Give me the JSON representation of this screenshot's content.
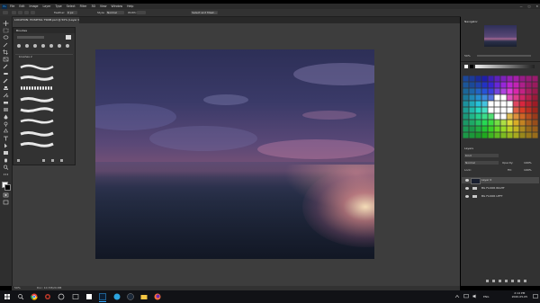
{
  "app": {
    "logo_text": "Ps",
    "menu": [
      "File",
      "Edit",
      "Image",
      "Layer",
      "Type",
      "Select",
      "Filter",
      "3D",
      "View",
      "Window",
      "Help"
    ],
    "window_controls": [
      "—",
      "□",
      "✕"
    ]
  },
  "options": {
    "feather_label": "Feather:",
    "feather_value": "0 px",
    "style_label": "Style:",
    "style_value": "Normal",
    "w_label": "Width:",
    "select_mask": "Select and Mask..."
  },
  "document": {
    "tab_title": "LOCATION: HOSPITAL TSNM.psd @ 50% (Layer 0, RGB/8)",
    "zoom": "50%",
    "doc_info": "Doc: 10.7M/20.8M"
  },
  "brushes_panel": {
    "title": "Brushes",
    "group_name": "brushes 2"
  },
  "navigator": {
    "title": "Navigator",
    "zoom": "50%"
  },
  "layers_panel": {
    "title": "Layers",
    "kind_label": "Kind",
    "blend_mode": "Normal",
    "opacity_label": "Opacity:",
    "opacity_value": "100%",
    "lock_label": "Lock:",
    "fill_label": "Fill:",
    "fill_value": "100%",
    "layers": [
      {
        "name": "Layer 0",
        "type": "layer",
        "selected": true
      },
      {
        "name": "BG FLOOR RIGHT",
        "type": "group",
        "selected": false
      },
      {
        "name": "BG FLOOR LEFT",
        "type": "group",
        "selected": false
      }
    ]
  },
  "taskbar": {
    "time": "2:14 PM",
    "date": "2020-05-05",
    "lang": "ENG",
    "icons": [
      "windows-icon",
      "search-icon",
      "chrome-icon",
      "cortana-icon",
      "task-view-icon",
      "vscode-icon",
      "photoshop-icon",
      "steam-icon",
      "file-explorer-icon",
      "firefox-icon"
    ]
  },
  "colors": {
    "accent": "#31a8ff",
    "workspace": "#3d3d3d",
    "panel": "#323232"
  }
}
